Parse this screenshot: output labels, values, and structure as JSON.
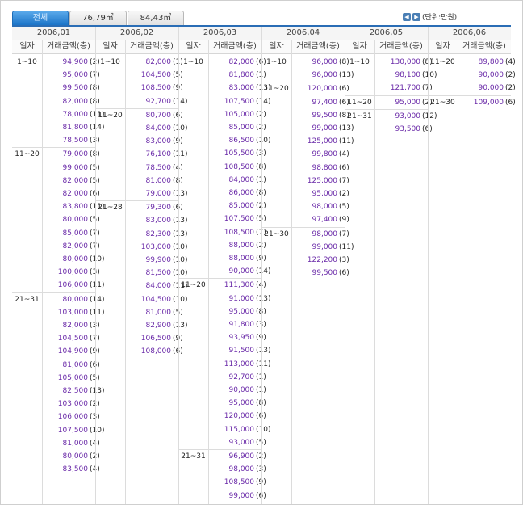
{
  "tabs": [
    {
      "label": "전체",
      "active": true
    },
    {
      "label": "76,79㎡",
      "active": false
    },
    {
      "label": "84,43㎡",
      "active": false
    }
  ],
  "unit_label": "(단위:만원)",
  "col_headers": {
    "date": "일자",
    "amount": "거래금액(층)"
  },
  "months": [
    {
      "label": "2006,01",
      "groups": [
        {
          "range": "1~10",
          "deals": [
            [
              "94,900",
              "(2)"
            ],
            [
              "95,000",
              "(7)"
            ],
            [
              "99,500",
              "(8)"
            ],
            [
              "82,000",
              "(8)"
            ],
            [
              "78,000",
              "(11)"
            ],
            [
              "81,800",
              "(14)"
            ],
            [
              "78,500",
              "(3)"
            ]
          ]
        },
        {
          "range": "11~20",
          "deals": [
            [
              "79,000",
              "(8)"
            ],
            [
              "99,000",
              "(5)"
            ],
            [
              "82,000",
              "(5)"
            ],
            [
              "82,000",
              "(6)"
            ],
            [
              "83,800",
              "(11)"
            ],
            [
              "80,000",
              "(5)"
            ],
            [
              "85,000",
              "(7)"
            ],
            [
              "82,000",
              "(7)"
            ],
            [
              "80,000",
              "(10)"
            ],
            [
              "100,000",
              "(3)"
            ],
            [
              "106,000",
              "(11)"
            ]
          ]
        },
        {
          "range": "21~31",
          "deals": [
            [
              "80,000",
              "(14)"
            ],
            [
              "103,000",
              "(11)"
            ],
            [
              "82,000",
              "(3)"
            ],
            [
              "104,500",
              "(7)"
            ],
            [
              "104,900",
              "(9)"
            ],
            [
              "81,000",
              "(6)"
            ],
            [
              "105,000",
              "(5)"
            ],
            [
              "82,500",
              "(13)"
            ],
            [
              "103,000",
              "(2)"
            ],
            [
              "106,000",
              "(3)"
            ],
            [
              "107,500",
              "(10)"
            ],
            [
              "81,000",
              "(4)"
            ],
            [
              "80,000",
              "(2)"
            ],
            [
              "83,500",
              "(4)"
            ]
          ]
        }
      ]
    },
    {
      "label": "2006,02",
      "groups": [
        {
          "range": "1~10",
          "deals": [
            [
              "82,000",
              "(1)"
            ],
            [
              "104,500",
              "(5)"
            ],
            [
              "108,500",
              "(9)"
            ],
            [
              "92,700",
              "(14)"
            ]
          ]
        },
        {
          "range": "11~20",
          "deals": [
            [
              "80,700",
              "(6)"
            ],
            [
              "84,000",
              "(10)"
            ],
            [
              "83,000",
              "(9)"
            ],
            [
              "76,100",
              "(11)"
            ],
            [
              "78,500",
              "(4)"
            ],
            [
              "81,000",
              "(8)"
            ],
            [
              "79,000",
              "(13)"
            ]
          ]
        },
        {
          "range": "21~28",
          "deals": [
            [
              "79,300",
              "(6)"
            ],
            [
              "83,000",
              "(13)"
            ],
            [
              "82,300",
              "(13)"
            ],
            [
              "103,000",
              "(10)"
            ],
            [
              "99,900",
              "(10)"
            ],
            [
              "81,500",
              "(10)"
            ],
            [
              "84,000",
              "(11)"
            ],
            [
              "104,500",
              "(10)"
            ],
            [
              "81,000",
              "(5)"
            ],
            [
              "82,900",
              "(13)"
            ],
            [
              "106,500",
              "(9)"
            ],
            [
              "108,000",
              "(6)"
            ]
          ]
        }
      ]
    },
    {
      "label": "2006,03",
      "groups": [
        {
          "range": "1~10",
          "deals": [
            [
              "82,000",
              "(6)"
            ],
            [
              "81,800",
              "(1)"
            ],
            [
              "83,000",
              "(13)"
            ],
            [
              "107,500",
              "(14)"
            ],
            [
              "105,000",
              "(2)"
            ],
            [
              "85,000",
              "(2)"
            ],
            [
              "86,500",
              "(10)"
            ],
            [
              "105,500",
              "(3)"
            ],
            [
              "108,500",
              "(8)"
            ],
            [
              "84,000",
              "(1)"
            ],
            [
              "86,000",
              "(8)"
            ],
            [
              "85,000",
              "(2)"
            ],
            [
              "107,500",
              "(5)"
            ],
            [
              "108,500",
              "(7)"
            ],
            [
              "88,000",
              "(2)"
            ],
            [
              "88,000",
              "(9)"
            ],
            [
              "90,000",
              "(14)"
            ]
          ]
        },
        {
          "range": "11~20",
          "deals": [
            [
              "111,300",
              "(4)"
            ],
            [
              "91,000",
              "(13)"
            ],
            [
              "95,000",
              "(8)"
            ],
            [
              "91,800",
              "(3)"
            ],
            [
              "93,950",
              "(9)"
            ],
            [
              "91,500",
              "(13)"
            ],
            [
              "113,000",
              "(11)"
            ],
            [
              "92,700",
              "(1)"
            ],
            [
              "90,000",
              "(1)"
            ],
            [
              "95,000",
              "(8)"
            ],
            [
              "120,000",
              "(6)"
            ],
            [
              "115,000",
              "(10)"
            ],
            [
              "93,000",
              "(5)"
            ]
          ]
        },
        {
          "range": "21~31",
          "deals": [
            [
              "96,900",
              "(2)"
            ],
            [
              "98,000",
              "(3)"
            ],
            [
              "108,500",
              "(9)"
            ],
            [
              "99,000",
              "(6)"
            ]
          ]
        }
      ]
    },
    {
      "label": "2006,04",
      "groups": [
        {
          "range": "1~10",
          "deals": [
            [
              "96,000",
              "(8)"
            ],
            [
              "96,000",
              "(13)"
            ]
          ]
        },
        {
          "range": "11~20",
          "deals": [
            [
              "120,000",
              "(6)"
            ],
            [
              "97,400",
              "(6)"
            ],
            [
              "99,500",
              "(8)"
            ],
            [
              "99,000",
              "(13)"
            ],
            [
              "125,000",
              "(11)"
            ],
            [
              "99,800",
              "(4)"
            ],
            [
              "98,800",
              "(6)"
            ],
            [
              "125,000",
              "(7)"
            ],
            [
              "95,000",
              "(2)"
            ],
            [
              "98,000",
              "(5)"
            ],
            [
              "97,400",
              "(9)"
            ]
          ]
        },
        {
          "range": "21~30",
          "deals": [
            [
              "98,000",
              "(7)"
            ],
            [
              "99,000",
              "(11)"
            ],
            [
              "122,200",
              "(3)"
            ],
            [
              "99,500",
              "(6)"
            ]
          ]
        }
      ]
    },
    {
      "label": "2006,05",
      "groups": [
        {
          "range": "1~10",
          "deals": [
            [
              "130,000",
              "(8)"
            ],
            [
              "98,100",
              "(10)"
            ],
            [
              "121,700",
              "(7)"
            ]
          ]
        },
        {
          "range": "11~20",
          "deals": [
            [
              "95,000",
              "(2)"
            ]
          ]
        },
        {
          "range": "21~31",
          "deals": [
            [
              "93,000",
              "(12)"
            ],
            [
              "93,500",
              "(6)"
            ]
          ]
        }
      ]
    },
    {
      "label": "2006,06",
      "groups": [
        {
          "range": "11~20",
          "deals": [
            [
              "89,800",
              "(4)"
            ],
            [
              "90,000",
              "(2)"
            ],
            [
              "90,000",
              "(2)"
            ]
          ]
        },
        {
          "range": "21~30",
          "deals": [
            [
              "109,000",
              "(6)"
            ]
          ]
        }
      ]
    }
  ]
}
